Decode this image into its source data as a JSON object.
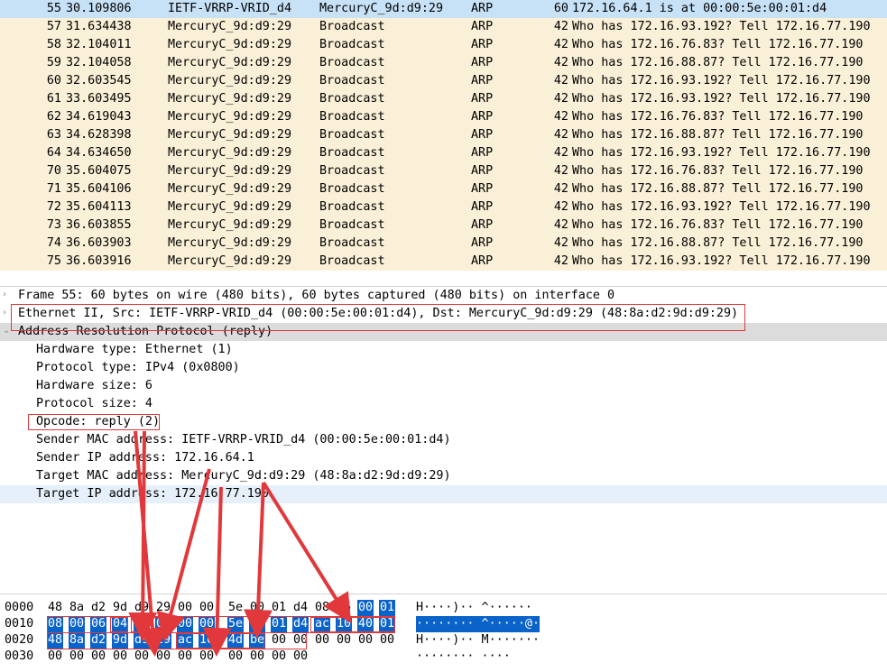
{
  "packet_list": {
    "rows": [
      {
        "no": "55",
        "time": "30.109806",
        "source": "IETF-VRRP-VRID_d4",
        "destination": "MercuryC_9d:d9:29",
        "protocol": "ARP",
        "length": "60",
        "info": "172.16.64.1 is at 00:00:5e:00:01:d4",
        "selected": true
      },
      {
        "no": "57",
        "time": "31.634438",
        "source": "MercuryC_9d:d9:29",
        "destination": "Broadcast",
        "protocol": "ARP",
        "length": "42",
        "info": "Who has 172.16.93.192? Tell 172.16.77.190"
      },
      {
        "no": "58",
        "time": "32.104011",
        "source": "MercuryC_9d:d9:29",
        "destination": "Broadcast",
        "protocol": "ARP",
        "length": "42",
        "info": "Who has 172.16.76.83? Tell 172.16.77.190"
      },
      {
        "no": "59",
        "time": "32.104058",
        "source": "MercuryC_9d:d9:29",
        "destination": "Broadcast",
        "protocol": "ARP",
        "length": "42",
        "info": "Who has 172.16.88.87? Tell 172.16.77.190"
      },
      {
        "no": "60",
        "time": "32.603545",
        "source": "MercuryC_9d:d9:29",
        "destination": "Broadcast",
        "protocol": "ARP",
        "length": "42",
        "info": "Who has 172.16.93.192? Tell 172.16.77.190"
      },
      {
        "no": "61",
        "time": "33.603495",
        "source": "MercuryC_9d:d9:29",
        "destination": "Broadcast",
        "protocol": "ARP",
        "length": "42",
        "info": "Who has 172.16.93.192? Tell 172.16.77.190"
      },
      {
        "no": "62",
        "time": "34.619043",
        "source": "MercuryC_9d:d9:29",
        "destination": "Broadcast",
        "protocol": "ARP",
        "length": "42",
        "info": "Who has 172.16.76.83? Tell 172.16.77.190"
      },
      {
        "no": "63",
        "time": "34.628398",
        "source": "MercuryC_9d:d9:29",
        "destination": "Broadcast",
        "protocol": "ARP",
        "length": "42",
        "info": "Who has 172.16.88.87? Tell 172.16.77.190"
      },
      {
        "no": "64",
        "time": "34.634650",
        "source": "MercuryC_9d:d9:29",
        "destination": "Broadcast",
        "protocol": "ARP",
        "length": "42",
        "info": "Who has 172.16.93.192? Tell 172.16.77.190"
      },
      {
        "no": "70",
        "time": "35.604075",
        "source": "MercuryC_9d:d9:29",
        "destination": "Broadcast",
        "protocol": "ARP",
        "length": "42",
        "info": "Who has 172.16.76.83? Tell 172.16.77.190"
      },
      {
        "no": "71",
        "time": "35.604106",
        "source": "MercuryC_9d:d9:29",
        "destination": "Broadcast",
        "protocol": "ARP",
        "length": "42",
        "info": "Who has 172.16.88.87? Tell 172.16.77.190"
      },
      {
        "no": "72",
        "time": "35.604113",
        "source": "MercuryC_9d:d9:29",
        "destination": "Broadcast",
        "protocol": "ARP",
        "length": "42",
        "info": "Who has 172.16.93.192? Tell 172.16.77.190"
      },
      {
        "no": "73",
        "time": "36.603855",
        "source": "MercuryC_9d:d9:29",
        "destination": "Broadcast",
        "protocol": "ARP",
        "length": "42",
        "info": "Who has 172.16.76.83? Tell 172.16.77.190"
      },
      {
        "no": "74",
        "time": "36.603903",
        "source": "MercuryC_9d:d9:29",
        "destination": "Broadcast",
        "protocol": "ARP",
        "length": "42",
        "info": "Who has 172.16.88.87? Tell 172.16.77.190"
      },
      {
        "no": "75",
        "time": "36.603916",
        "source": "MercuryC_9d:d9:29",
        "destination": "Broadcast",
        "protocol": "ARP",
        "length": "42",
        "info": "Who has 172.16.93.192? Tell 172.16.77.190"
      }
    ]
  },
  "details": {
    "frame": "Frame 55: 60 bytes on wire (480 bits), 60 bytes captured (480 bits) on interface 0",
    "ethernet": "Ethernet II, Src: IETF-VRRP-VRID_d4 (00:00:5e:00:01:d4), Dst: MercuryC_9d:d9:29 (48:8a:d2:9d:d9:29)",
    "arp": "Address Resolution Protocol (reply)",
    "arp_fields": [
      "Hardware type: Ethernet (1)",
      "Protocol type: IPv4 (0x0800)",
      "Hardware size: 6",
      "Protocol size: 4",
      "Opcode: reply (2)",
      "Sender MAC address: IETF-VRRP-VRID_d4 (00:00:5e:00:01:d4)",
      "Sender IP address: 172.16.64.1",
      "Target MAC address: MercuryC_9d:d9:29 (48:8a:d2:9d:d9:29)",
      "Target IP address: 172.16.77.190"
    ],
    "collapsed_arrow": "›",
    "expanded_arrow": "⌄"
  },
  "hexdump": {
    "lines": [
      {
        "offset": "0000",
        "bytes": [
          "48",
          "8a",
          "d2",
          "9d",
          "d9",
          "29",
          "00",
          "00",
          "5e",
          "00",
          "01",
          "d4",
          "08",
          "06",
          "00",
          "01"
        ],
        "ascii": "H····)·· ^······"
      },
      {
        "offset": "0010",
        "bytes": [
          "08",
          "00",
          "06",
          "04",
          "00",
          "02",
          "00",
          "00",
          "5e",
          "00",
          "01",
          "d4",
          "ac",
          "10",
          "40",
          "01"
        ],
        "ascii": "········ ^·····@·"
      },
      {
        "offset": "0020",
        "bytes": [
          "48",
          "8a",
          "d2",
          "9d",
          "d9",
          "29",
          "ac",
          "10",
          "4d",
          "be",
          "00",
          "00",
          "00",
          "00",
          "00",
          "00"
        ],
        "ascii": "H····)·· M·······"
      },
      {
        "offset": "0030",
        "bytes": [
          "00",
          "00",
          "00",
          "00",
          "00",
          "00",
          "00",
          "00",
          "00",
          "00",
          "00",
          "00"
        ],
        "ascii": "········ ····"
      }
    ]
  },
  "colors": {
    "row_bg": "#faf0d7",
    "selected_row_bg": "#c7e2f7",
    "hex_highlight": "#0a63c9",
    "annotation_red": "#e0383b"
  }
}
